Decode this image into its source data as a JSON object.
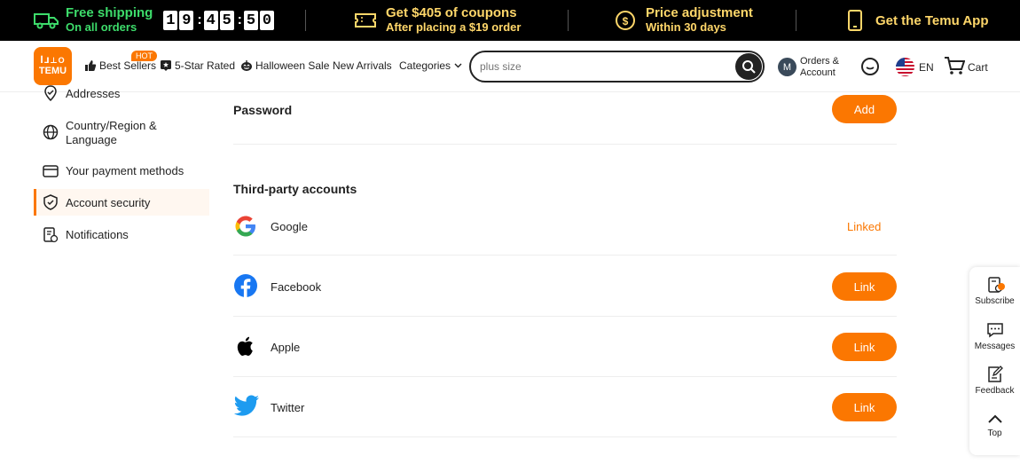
{
  "promo": {
    "shipping_title": "Free shipping",
    "shipping_sub": "On all orders",
    "timer": [
      "1",
      "9",
      "4",
      "5",
      "5",
      "0"
    ],
    "coupon_title": "Get $405 of coupons",
    "coupon_sub": "After placing a $19 order",
    "price_title": "Price adjustment",
    "price_sub": "Within 30 days",
    "app_title": "Get the Temu App"
  },
  "header": {
    "logo_top": "ꟾ⅃⊥O",
    "logo_bottom": "TEMU",
    "hot_badge": "HOT",
    "nav": [
      "Best Sellers",
      "5-Star Rated",
      "Halloween Sale",
      "New Arrivals",
      "Categories"
    ],
    "search_placeholder": "plus size",
    "avatar_letter": "M",
    "orders_line1": "Orders &",
    "orders_line2": "Account",
    "lang": "EN",
    "cart": "Cart"
  },
  "sidebar": {
    "items": [
      {
        "label": "Addresses"
      },
      {
        "label": "Country/Region &"
      },
      {
        "label": "Language"
      },
      {
        "label": "Your payment methods"
      },
      {
        "label": "Account security"
      },
      {
        "label": "Notifications"
      }
    ]
  },
  "main": {
    "password_title": "Password",
    "password_button": "Add",
    "third_party_title": "Third-party accounts",
    "accounts": [
      {
        "name": "Google",
        "status": "Linked"
      },
      {
        "name": "Facebook",
        "button": "Link"
      },
      {
        "name": "Apple",
        "button": "Link"
      },
      {
        "name": "Twitter",
        "button": "Link"
      }
    ]
  },
  "float": {
    "subscribe": "Subscribe",
    "messages": "Messages",
    "feedback": "Feedback",
    "top": "Top"
  },
  "colors": {
    "accent": "#fb7701",
    "promo_green": "#3ddc6b",
    "promo_gold": "#ffd76a"
  }
}
